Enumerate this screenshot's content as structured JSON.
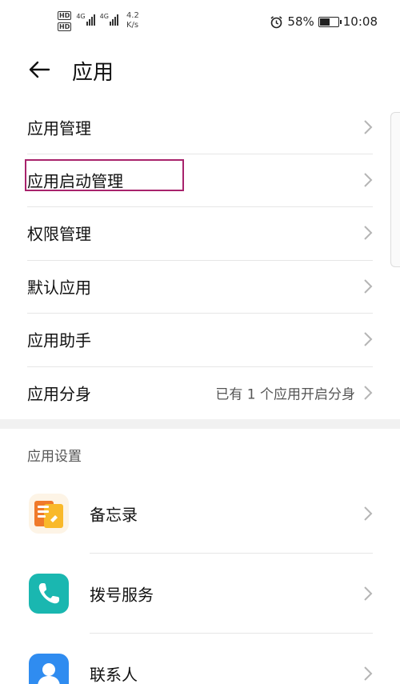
{
  "status_bar": {
    "sim1_badge": "HD",
    "sim2_badge": "HD",
    "network1": "4G",
    "network2": "4G",
    "speed_value": "4.2",
    "speed_unit": "K/s",
    "battery_percent_text": "58%",
    "battery_level": 0.58,
    "time": "10:08"
  },
  "header": {
    "title": "应用",
    "back_icon": "arrow-left-icon"
  },
  "menu": {
    "items": [
      {
        "label": "应用管理"
      },
      {
        "label": "应用启动管理"
      },
      {
        "label": "权限管理"
      },
      {
        "label": "默认应用"
      },
      {
        "label": "应用助手"
      },
      {
        "label": "应用分身",
        "meta": "已有 1 个应用开启分身"
      }
    ]
  },
  "app_settings": {
    "section_title": "应用设置",
    "apps": [
      {
        "label": "备忘录",
        "icon": "notepad-icon",
        "color": "#f5a623"
      },
      {
        "label": "拨号服务",
        "icon": "phone-icon",
        "color": "#1ab7b0"
      },
      {
        "label": "联系人",
        "icon": "contacts-icon",
        "color": "#2f8cf0"
      }
    ]
  },
  "colors": {
    "highlight_border": "#a8236c",
    "chevron": "#b5b5b5"
  }
}
